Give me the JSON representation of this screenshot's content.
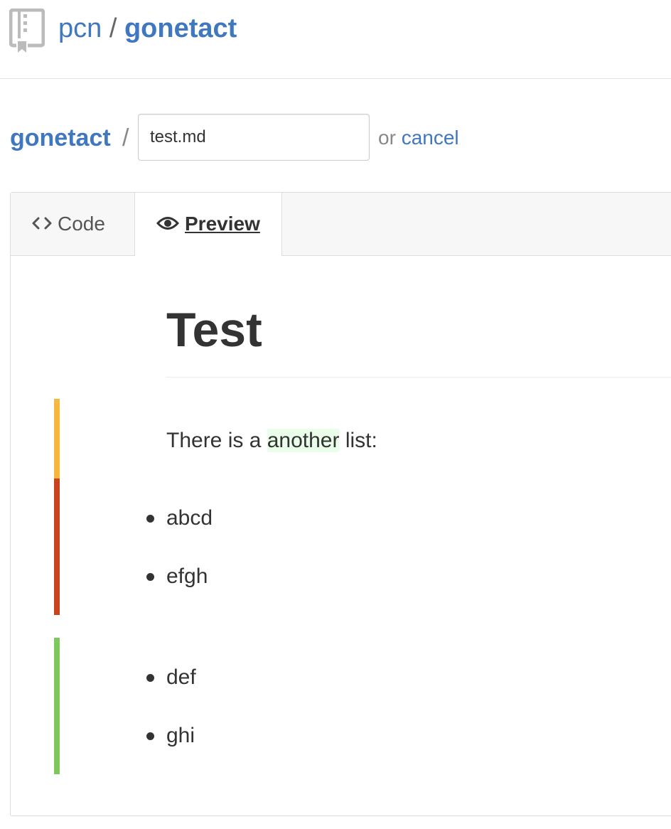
{
  "header": {
    "owner": "pcn",
    "separator": "/",
    "repo": "gonetact",
    "icon": "repo-icon"
  },
  "path": {
    "root": "gonetact",
    "separator": "/",
    "filename": "test.md",
    "or_text": "or",
    "cancel_label": "cancel"
  },
  "tabs": [
    {
      "label": "Code",
      "icon": "code-icon",
      "active": false
    },
    {
      "label": "Preview",
      "icon": "eye-icon",
      "active": true
    }
  ],
  "preview": {
    "title": "Test",
    "paragraph": {
      "before": "There is a ",
      "added": "another",
      "after": " list:"
    },
    "list_removed": [
      "abcd",
      "efgh"
    ],
    "list_added": [
      "def",
      "ghi"
    ]
  },
  "colors": {
    "link": "#4078c0",
    "diff_changed": "#f5b83d",
    "diff_removed": "#c9421d",
    "diff_added": "#7dc95e",
    "added_highlight": "#eaffea"
  }
}
